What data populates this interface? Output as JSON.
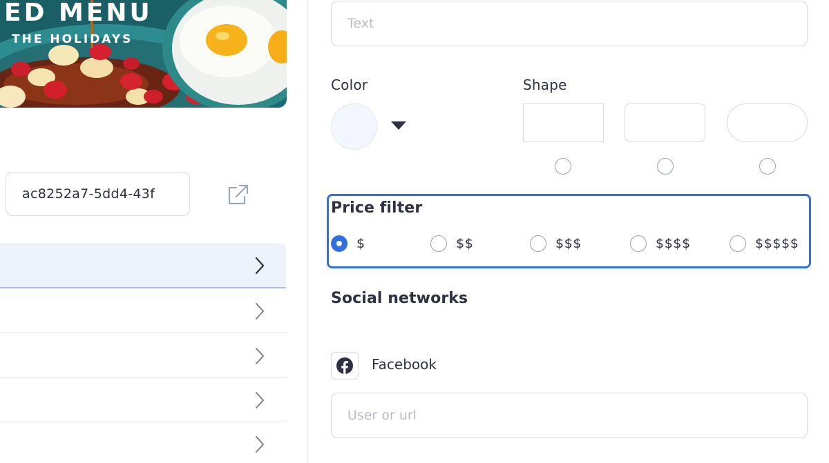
{
  "banner": {
    "headline": "ED MENU",
    "subline": "THE HOLIDAYS"
  },
  "left_panel": {
    "id_value": "ac8252a7-5dd4-43f",
    "list_rows": 5
  },
  "form": {
    "text_placeholder": "Text",
    "color_label": "Color",
    "color_value": "#f4f6fd",
    "shape_label": "Shape",
    "shape_options": [
      "square",
      "rounded",
      "pill"
    ],
    "price_filter": {
      "title": "Price filter",
      "options": [
        "$",
        "$$",
        "$$$",
        "$$$$",
        "$$$$$"
      ],
      "selected": "$"
    },
    "social": {
      "title": "Social networks",
      "facebook_label": "Facebook",
      "user_placeholder": "User or url"
    }
  },
  "colors": {
    "accent": "#2f6fe0",
    "text": "#2d3142",
    "placeholder": "#b6bcc6",
    "border": "#d6d9de",
    "active_row_bg": "#eef2fb"
  },
  "icons": {
    "dropdown": "caret-down-icon",
    "external": "external-link-icon",
    "chevron": "chevron-right-icon",
    "facebook": "facebook-icon"
  }
}
